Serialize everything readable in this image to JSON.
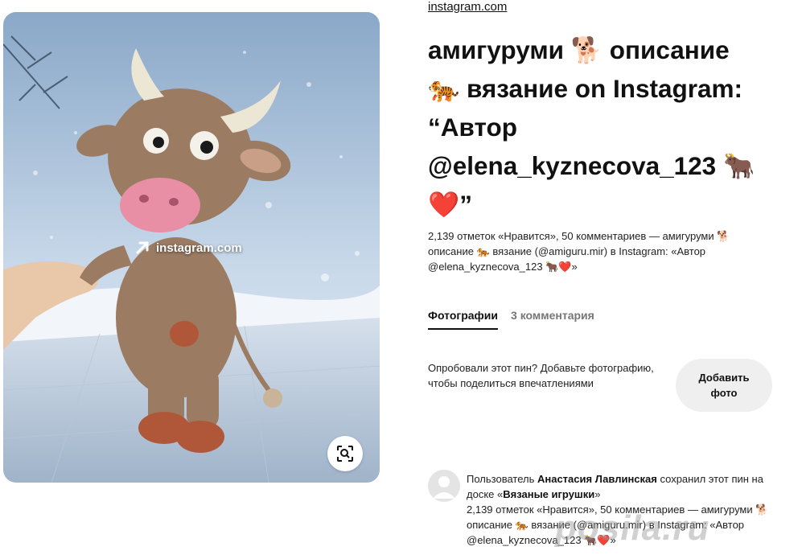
{
  "pin": {
    "image_alt": "amigurumi cow",
    "source_overlay": "instagram.com",
    "lens_icon": "visual-search-icon"
  },
  "header": {
    "domain": "instagram.com",
    "title": "амигуруми 🐕 описание 🐅 вязание on Instagram: “Автор @elena_kyznecova_123 🐂❤️”",
    "description": "2,139 отметок «Нравится», 50 комментариев — амигуруми 🐕 описание 🐅 вязание (@amiguru.mir) в Instagram: «Автор @elena_kyznecova_123 🐂❤️»"
  },
  "tabs": [
    {
      "label": "Фотографии",
      "active": true
    },
    {
      "label": "3 комментария",
      "active": false
    }
  ],
  "tried": {
    "text": "Опробовали этот пин? Добавьте фотографию, чтобы поделиться впечатлениями",
    "button_label": "Добавить фото"
  },
  "activity": {
    "prefix": "Пользователь ",
    "user": "Анастасия Лавлинская",
    "middle": " сохранил этот пин на доске «",
    "board": "Вязаные игрушки",
    "suffix": "»",
    "description": "2,139 отметок «Нравится», 50 комментариев — амигуруми 🐕 описание 🐅 вязание (@amiguru.mir) в Instagram: «Автор @elena_kyznecova_123 🐂❤️»"
  },
  "watermark": "posila.ru"
}
